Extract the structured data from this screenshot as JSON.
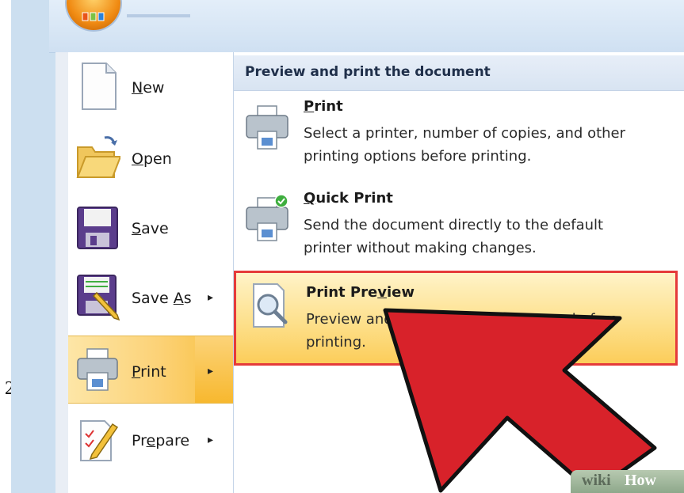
{
  "step_number": "2.",
  "left_menu": {
    "items": [
      {
        "pre": "",
        "u": "N",
        "post": "ew",
        "arrow": ""
      },
      {
        "pre": "",
        "u": "O",
        "post": "pen",
        "arrow": ""
      },
      {
        "pre": "",
        "u": "S",
        "post": "ave",
        "arrow": ""
      },
      {
        "pre": "Save ",
        "u": "A",
        "post": "s",
        "arrow": "▸"
      },
      {
        "pre": "",
        "u": "P",
        "post": "rint",
        "arrow": "▸"
      },
      {
        "pre": "Pr",
        "u": "e",
        "post": "pare",
        "arrow": "▸"
      }
    ]
  },
  "right_panel": {
    "header": "Preview and print the document",
    "options": [
      {
        "pre": "",
        "u": "P",
        "post": "rint",
        "desc": "Select a printer, number of copies, and other printing options before printing."
      },
      {
        "pre": "",
        "u": "Q",
        "post": "uick Print",
        "desc": "Send the document directly to the default printer without making changes."
      },
      {
        "pre": "Print Pre",
        "u": "v",
        "post": "iew",
        "desc": "Preview and make changes to pages before printing."
      }
    ]
  },
  "watermark": {
    "wiki": "wiki",
    "how": "How"
  },
  "colors": {
    "highlight_border": "#e53a3a",
    "arrow": "#d8222a",
    "active_item": "#fcd277"
  }
}
